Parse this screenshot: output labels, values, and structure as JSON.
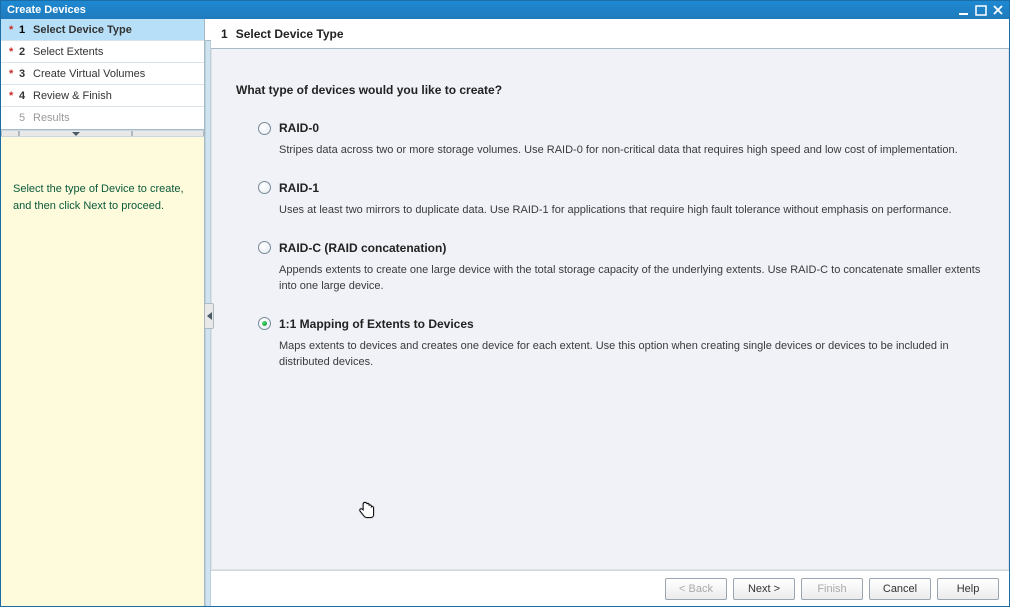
{
  "window": {
    "title": "Create Devices"
  },
  "steps": [
    {
      "num": "1",
      "label": "Select Device Type",
      "required": true,
      "active": true,
      "disabled": false
    },
    {
      "num": "2",
      "label": "Select Extents",
      "required": true,
      "active": false,
      "disabled": false
    },
    {
      "num": "3",
      "label": "Create Virtual Volumes",
      "required": true,
      "active": false,
      "disabled": false
    },
    {
      "num": "4",
      "label": "Review & Finish",
      "required": true,
      "active": false,
      "disabled": false
    },
    {
      "num": "5",
      "label": "Results",
      "required": false,
      "active": false,
      "disabled": true
    }
  ],
  "hint": "Select the type of Device to create, and then click Next to proceed.",
  "main": {
    "heading_num": "1",
    "heading": "Select Device Type",
    "question": "What type of devices would you like to create?",
    "options": [
      {
        "id": "raid0",
        "title": "RAID-0",
        "desc": "Stripes data across two or more storage volumes. Use RAID-0 for non-critical data that requires high speed and low cost of implementation.",
        "selected": false
      },
      {
        "id": "raid1",
        "title": "RAID-1",
        "desc": "Uses at least two mirrors to duplicate data. Use RAID-1 for applications that require high fault tolerance without emphasis on performance.",
        "selected": false
      },
      {
        "id": "raidc",
        "title": "RAID-C (RAID concatenation)",
        "desc": "Appends extents to create one large device with the total storage capacity of the underlying extents. Use RAID-C to concatenate smaller extents into one large device.",
        "selected": false
      },
      {
        "id": "map11",
        "title": "1:1 Mapping of Extents to Devices",
        "desc": "Maps extents to devices and creates one device for each extent.  Use this option when creating single devices or devices to be included in distributed devices.",
        "selected": true
      }
    ]
  },
  "footer": {
    "back": "< Back",
    "next": "Next >",
    "finish": "Finish",
    "cancel": "Cancel",
    "help": "Help"
  }
}
